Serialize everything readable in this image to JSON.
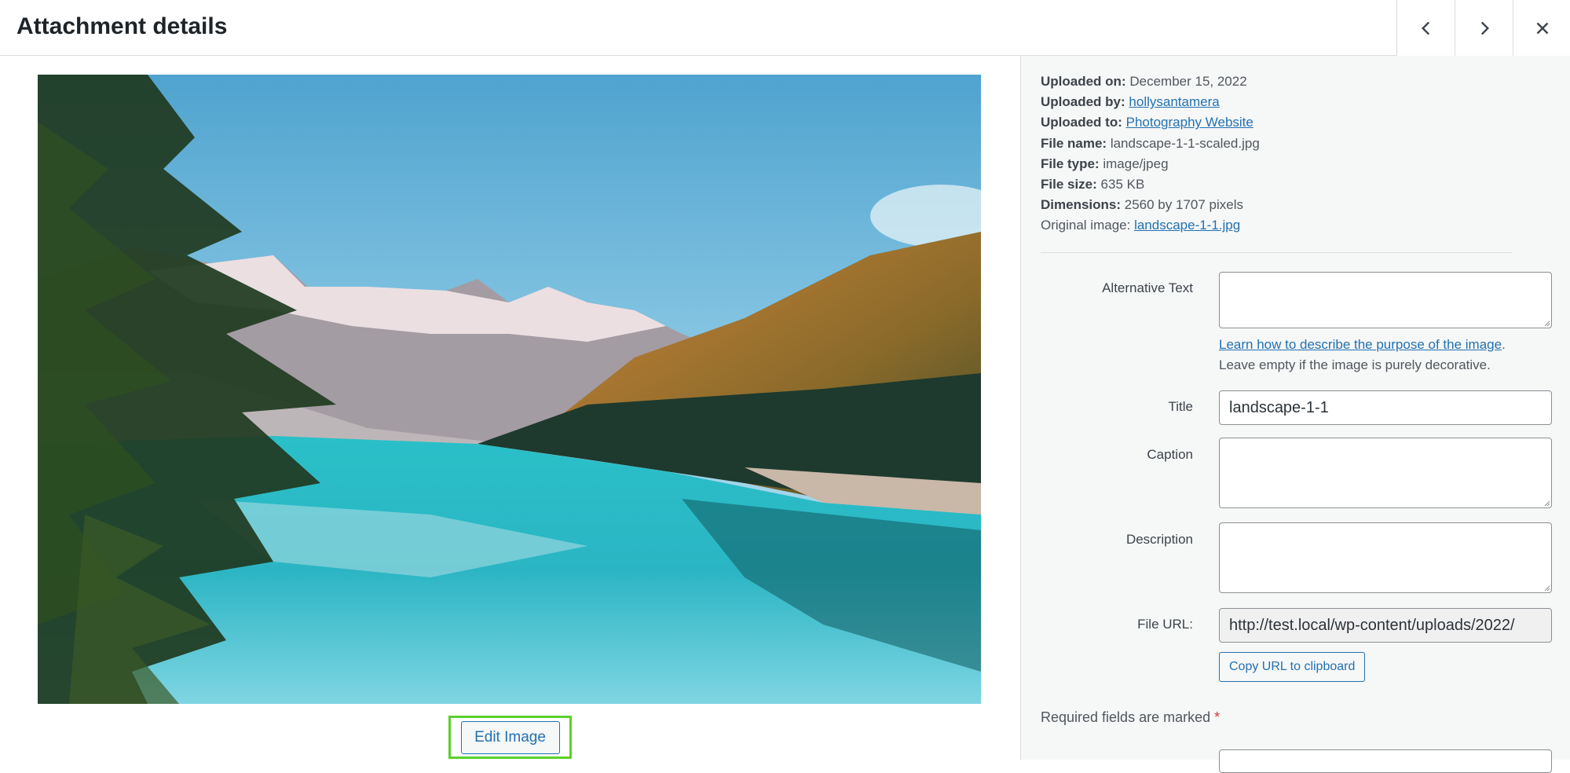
{
  "header": {
    "title": "Attachment details",
    "prev_icon": "chevron-left-icon",
    "next_icon": "chevron-right-icon",
    "close_icon": "close-icon"
  },
  "preview": {
    "image_icon": "landscape-photo",
    "edit_label": "Edit Image"
  },
  "meta": {
    "uploaded_on_label": "Uploaded on:",
    "uploaded_on": "December 15, 2022",
    "uploaded_by_label": "Uploaded by:",
    "uploaded_by": "hollysantamera",
    "uploaded_to_label": "Uploaded to:",
    "uploaded_to": "Photography Website",
    "file_name_label": "File name:",
    "file_name": "landscape-1-1-scaled.jpg",
    "file_type_label": "File type:",
    "file_type": "image/jpeg",
    "file_size_label": "File size:",
    "file_size": "635 KB",
    "dimensions_label": "Dimensions:",
    "dimensions": "2560 by 1707 pixels",
    "original_label": "Original image:",
    "original": "landscape-1-1.jpg"
  },
  "form": {
    "alt_label": "Alternative Text",
    "alt_value": "",
    "alt_help_link": "Learn how to describe the purpose of the image",
    "alt_help_dot": ".",
    "alt_help_text": "Leave empty if the image is purely decorative.",
    "title_label": "Title",
    "title_value": "landscape-1-1",
    "caption_label": "Caption",
    "caption_value": "",
    "description_label": "Description",
    "description_value": "",
    "url_label": "File URL:",
    "url_value": "http://test.local/wp-content/uploads/2022/",
    "copy_label": "Copy URL to clipboard",
    "required_text": "Required fields are marked",
    "required_star": "*"
  },
  "colors": {
    "accent": "#2271b1",
    "highlight": "#5ad12b",
    "panel_bg": "#f6f7f7"
  }
}
